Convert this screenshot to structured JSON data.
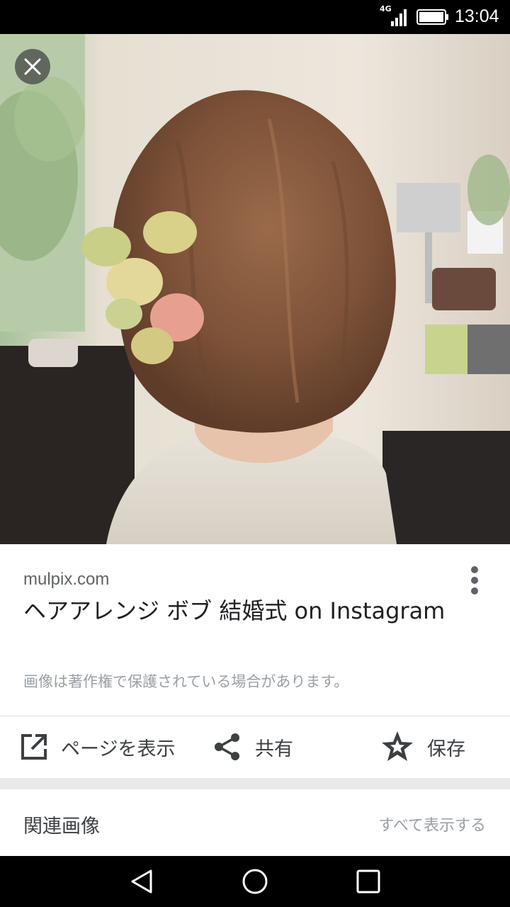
{
  "status_bar": {
    "network": "4G",
    "time": "13:04",
    "icons": [
      "signal-icon",
      "battery-icon"
    ]
  },
  "viewer": {
    "close_icon": "close-icon"
  },
  "result": {
    "source": "mulpix.com",
    "title": "ヘアアレンジ ボブ 結婚式 on Instagram",
    "copyright_notice": "画像は著作権で保護されている場合があります。",
    "more_icon": "more-vert-icon"
  },
  "actions": [
    {
      "label": "ページを表示",
      "icon": "open-in-new-icon"
    },
    {
      "label": "共有",
      "icon": "share-icon"
    },
    {
      "label": "保存",
      "icon": "star-save-icon"
    }
  ],
  "related": {
    "title": "関連画像",
    "see_all": "すべて表示する"
  },
  "nav_bar": {
    "icons": [
      "back-icon",
      "home-icon",
      "recents-icon"
    ]
  }
}
